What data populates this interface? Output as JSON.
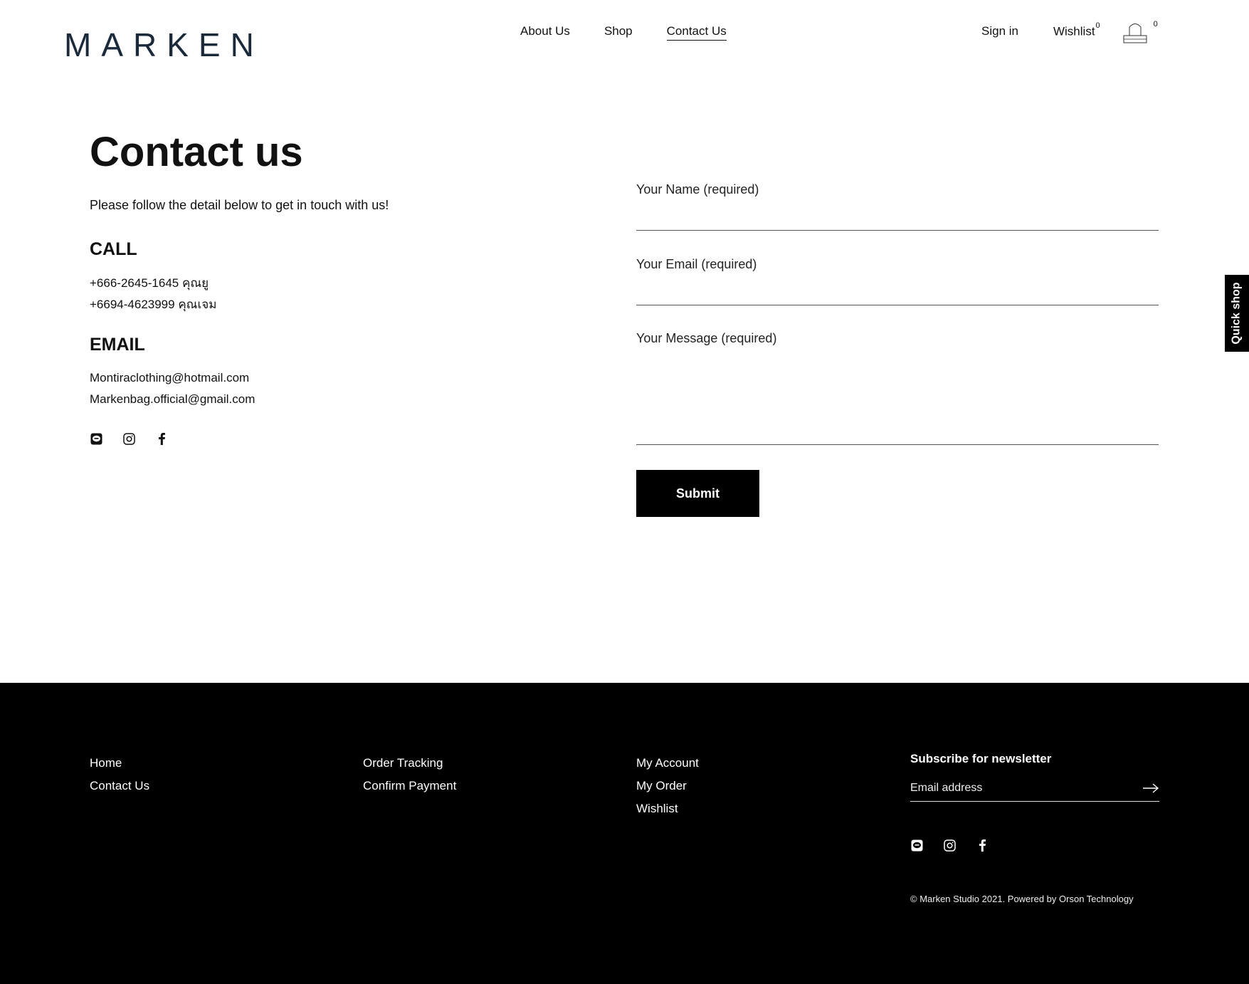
{
  "header": {
    "logo": "MARKEN",
    "nav": [
      {
        "label": "About Us"
      },
      {
        "label": "Shop"
      },
      {
        "label": "Contact Us"
      }
    ],
    "sign_in": "Sign in",
    "wishlist_label": "Wishlist",
    "wishlist_count": "0",
    "cart_count": "0"
  },
  "quick_shop": "Quick shop",
  "contact": {
    "title": "Contact us",
    "lead": "Please follow the detail below to get in touch with us!",
    "call_heading": "CALL",
    "phones": [
      "+666-2645-1645 คุณยู",
      "+6694-4623999 คุณเจม"
    ],
    "email_heading": "EMAIL",
    "emails": [
      "Montiraclothing@hotmail.com",
      "Markenbag.official@gmail.com"
    ],
    "socials": [
      "line-icon",
      "instagram-icon",
      "facebook-icon"
    ]
  },
  "form": {
    "name_label": "Your Name (required)",
    "email_label": "Your Email (required)",
    "message_label": "Your Message (required)",
    "submit_label": "Submit"
  },
  "footer": {
    "col1": [
      "Home",
      "Contact Us"
    ],
    "col2": [
      "Order Tracking",
      "Confirm Payment"
    ],
    "col3": [
      "My Account",
      "My Order",
      "Wishlist"
    ],
    "newsletter_title": "Subscribe for newsletter",
    "newsletter_placeholder": "Email address",
    "copyright": "© Marken Studio 2021. Powered by Orson Technology"
  },
  "colors": {
    "logo": "#1b2a3a",
    "footer_bg": "#000000",
    "button_bg": "#000000"
  }
}
